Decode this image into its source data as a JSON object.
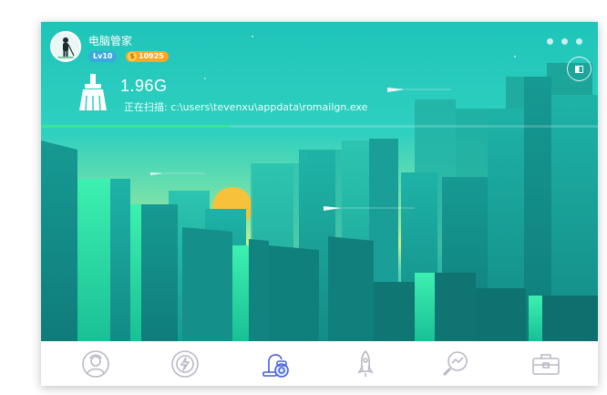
{
  "app": {
    "title": "电脑管家",
    "level_badge": "Lv10",
    "coin_symbol": "$",
    "coin_count": "10925"
  },
  "scan": {
    "cleaned_size": "1.96G",
    "status_prefix": "正在扫描: ",
    "current_path": "c:\\users\\tevenxu\\appdata\\romailgn.exe",
    "progress_fraction": 0.34
  },
  "colors": {
    "accent_green": "#3be39c",
    "sky_top": "#1fc4b9",
    "sun": "#f7c23a",
    "icon_default": "#b9b9c6",
    "icon_active": "#4a5fd8"
  },
  "bottom_nav": [
    {
      "icon": "user-icon",
      "active": false
    },
    {
      "icon": "shield-bolt-icon",
      "active": false
    },
    {
      "icon": "vacuum-cleaner-icon",
      "active": true
    },
    {
      "icon": "rocket-icon",
      "active": false
    },
    {
      "icon": "magnifier-chart-icon",
      "active": false
    },
    {
      "icon": "toolbox-icon",
      "active": false
    }
  ]
}
